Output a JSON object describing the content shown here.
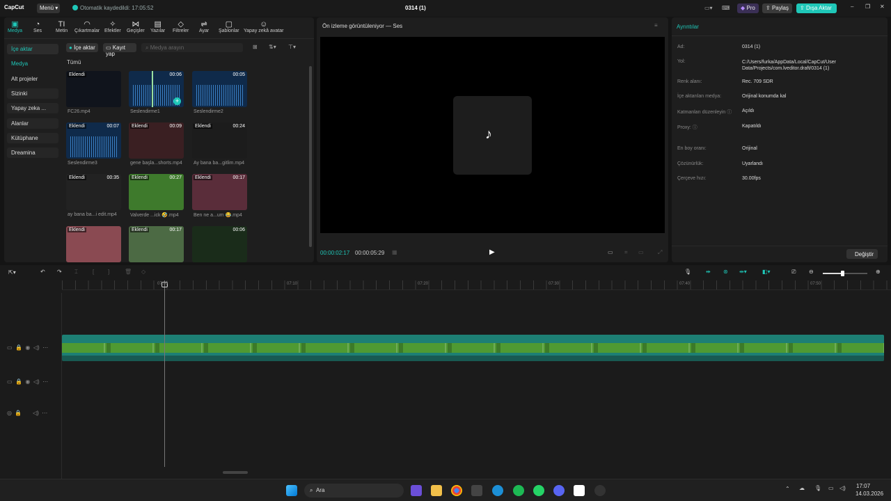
{
  "app": {
    "name": "CapCut",
    "menu_label": "Menü",
    "autosave": "Otomatik kaydedildi: 17:05:52",
    "project_title": "0314 (1)",
    "pro_label": "Pro",
    "share_label": "Paylaş",
    "export_label": "Dışa Aktar"
  },
  "toolbar": [
    {
      "label": "Medya",
      "icon": "media-icon",
      "glyph": "▣"
    },
    {
      "label": "Ses",
      "icon": "audio-icon",
      "glyph": "◔"
    },
    {
      "label": "Metin",
      "icon": "text-icon",
      "glyph": "TI"
    },
    {
      "label": "Çıkartmalar",
      "icon": "sticker-icon",
      "glyph": "◠"
    },
    {
      "label": "Efektler",
      "icon": "effects-icon",
      "glyph": "✧"
    },
    {
      "label": "Geçişler",
      "icon": "transition-icon",
      "glyph": "⋈"
    },
    {
      "label": "Yazılar",
      "icon": "caption-icon",
      "glyph": "▤"
    },
    {
      "label": "Filtreler",
      "icon": "filter-icon",
      "glyph": "◇"
    },
    {
      "label": "Ayar",
      "icon": "adjust-icon",
      "glyph": "⇌"
    },
    {
      "label": "Şablonlar",
      "icon": "template-icon",
      "glyph": "▢"
    },
    {
      "label": "Yapay zekâ avatar",
      "icon": "avatar-icon",
      "glyph": "☺"
    }
  ],
  "sidebar": [
    {
      "label": "İçe aktar"
    },
    {
      "label": "Medya"
    },
    {
      "label": "Alt projeler"
    },
    {
      "label": "Sizinki"
    },
    {
      "label": "Yapay zeka ..."
    },
    {
      "label": "Alanlar"
    },
    {
      "label": "Kütüphane"
    },
    {
      "label": "Dreamina"
    }
  ],
  "media_bar": {
    "import_label": "İçe aktar",
    "record_label": "Kayıt yap",
    "search_placeholder": "Medya arayın",
    "all_label": "Tümü"
  },
  "media_items": [
    {
      "name": "FC26.mp4",
      "duration": "",
      "badge": "Eklendi",
      "kind": "video"
    },
    {
      "name": "Seslendirme1",
      "duration": "00:06",
      "badge": "",
      "kind": "audio"
    },
    {
      "name": "Seslendirme2",
      "duration": "00:05",
      "badge": "",
      "kind": "audio"
    },
    {
      "name": "Seslendirme3",
      "duration": "00:07",
      "badge": "Eklendi",
      "kind": "audio"
    },
    {
      "name": "gene başla...shorts.mp4",
      "duration": "00:09",
      "badge": "Eklendi",
      "kind": "video"
    },
    {
      "name": "Ay bana ba...gitlim.mp4",
      "duration": "00:24",
      "badge": "Eklendi",
      "kind": "video"
    },
    {
      "name": "ay bana ba...i edit.mp4",
      "duration": "00:35",
      "badge": "Eklendi",
      "kind": "video"
    },
    {
      "name": "Valverde ...ick 🤣.mp4",
      "duration": "00:27",
      "badge": "Eklendi",
      "kind": "video"
    },
    {
      "name": "Ben ne a...um 😂.mp4",
      "duration": "00:17",
      "badge": "Eklendi",
      "kind": "video"
    },
    {
      "name": "",
      "duration": "",
      "badge": "Eklendi",
      "kind": "video"
    },
    {
      "name": "",
      "duration": "00:17",
      "badge": "Eklendi",
      "kind": "video"
    },
    {
      "name": "",
      "duration": "00:06",
      "badge": "",
      "kind": "video"
    }
  ],
  "preview": {
    "title": "Ön izleme görüntüleniyor — Ses",
    "current_time": "00:00:02:17",
    "total_time": "00:00:05:29"
  },
  "details": {
    "title": "Ayrıntılar",
    "change_label": "Değiştir",
    "rows": [
      {
        "label": "Ad:",
        "value": "0314 (1)"
      },
      {
        "label": "Yol:",
        "value": "C:/Users/furka/AppData/Local/CapCut/User Data/Projects/com.lveditor.draft/0314 (1)"
      },
      {
        "label": "Renk alanı:",
        "value": "Rec. 709 SDR"
      },
      {
        "label": "İçe aktarılan medya:",
        "value": "Orijinal konumda kal"
      },
      {
        "label": "Katmanları düzenleyin ⓘ",
        "value": "Açıldı"
      },
      {
        "label": "Proxy: ⓘ",
        "value": "Kapatıldı"
      },
      {
        "label": "En boy oranı:",
        "value": "Orijinal"
      },
      {
        "label": "Çözünürlük:",
        "value": "Uyarlandı"
      },
      {
        "label": "Çerçeve hızı:",
        "value": "30.00fps"
      }
    ]
  },
  "timeline": {
    "ticks": [
      "07:00",
      "07:10",
      "07:20",
      "07:30",
      "07:40",
      "07:50"
    ]
  },
  "taskbar": {
    "search_label": "Ara",
    "time": "17:07",
    "date": "14.03.2026"
  },
  "colors": {
    "accent": "#1fc7b8",
    "export": "#1fc7b8",
    "clip": "#57a33a"
  }
}
